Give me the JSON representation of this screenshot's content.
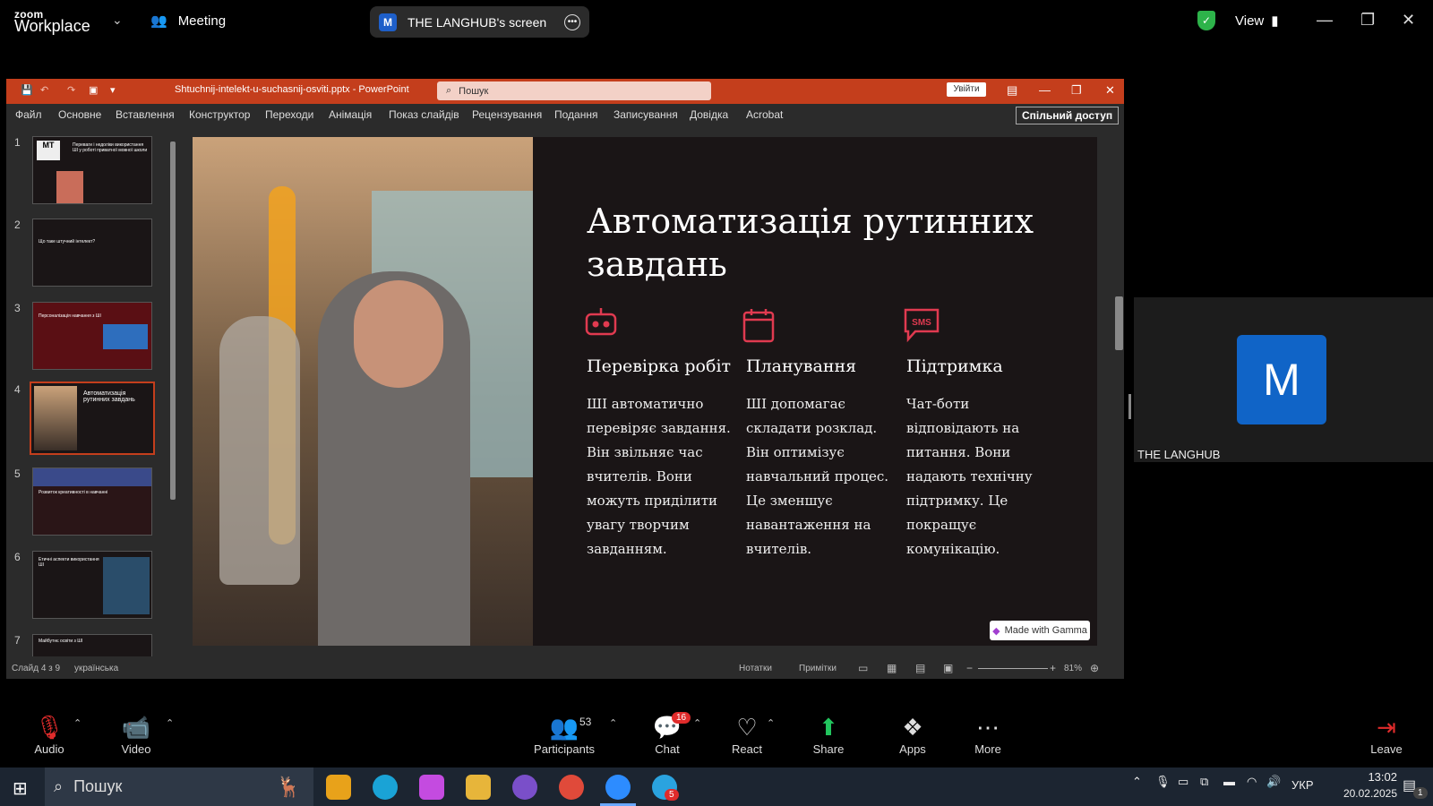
{
  "zoom": {
    "logo_small": "zoom",
    "logo_big": "Workplace",
    "meeting_label": "Meeting",
    "share_initial": "M",
    "share_label": "THE LANGHUB's screen",
    "view_label": "View",
    "participant_initial": "M",
    "participant_name": "THE LANGHUB",
    "toolbar": {
      "audio": "Audio",
      "video": "Video",
      "participants": "Participants",
      "participants_count": "53",
      "chat": "Chat",
      "chat_badge": "16",
      "react": "React",
      "share": "Share",
      "apps": "Apps",
      "more": "More",
      "leave": "Leave"
    }
  },
  "powerpoint": {
    "title": "Shtuchnij-intelekt-u-suchasnij-osviti.pptx  -  PowerPoint",
    "search_placeholder": "Пошук",
    "login_label": "Увійти",
    "share_access": "Спільний доступ",
    "ribbon_tabs": [
      "Файл",
      "Основне",
      "Вставлення",
      "Конструктор",
      "Переходи",
      "Анімація",
      "Показ слайдів",
      "Рецензування",
      "Подання",
      "Записування",
      "Довідка",
      "Acrobat"
    ],
    "thumbs": [
      "1",
      "2",
      "3",
      "4",
      "5",
      "6",
      "7"
    ],
    "thumb_text": {
      "t1_title": "Переваги і недоліки використання ШІ у роботі приватної мовної школи",
      "t2_title": "Що таке штучний інтелект?",
      "t3_title": "Персоналізація навчання з ШІ",
      "t4_title": "Автоматизація рутинних завдань",
      "t5_title": "Розвиток креативності в навчанні",
      "t6_title": "Етичні аспекти використання ШІ",
      "t7_title": "Майбутнє освіти з ШІ"
    },
    "status_slide": "Слайд 4 з 9",
    "status_lang": "українська",
    "notes": "Нотатки",
    "comments": "Примітки",
    "zoom_level": "81%"
  },
  "slide": {
    "title": "Автоматизація рутинних завдань",
    "columns": [
      {
        "icon": "robot-icon",
        "heading": "Перевірка робіт",
        "body": "ШІ автоматично перевіряє завдання. Він звільняє час вчителів. Вони можуть приділити увагу творчим завданням."
      },
      {
        "icon": "calendar-icon",
        "heading": "Планування",
        "body": "ШІ допомагає складати розклад. Він оптимізує навчальний процес. Це зменшує навантаження на вчителів."
      },
      {
        "icon": "sms-icon",
        "heading": "Підтримка",
        "body": "Чат-боти відповідають на питання. Вони надають технічну підтримку. Це покращує комунікацію."
      }
    ],
    "gamma_badge": "Made with Gamma",
    "icon_text_sms": "SMS"
  },
  "taskbar": {
    "search": "Пошук",
    "lang": "УКР",
    "time": "13:02",
    "date": "20.02.2025",
    "telegram_badge": "5",
    "notif_badge": "1"
  },
  "colors": {
    "accent": "#c43e1c",
    "slide_icon": "#e03a50",
    "zoom_blue": "#1064c7"
  }
}
